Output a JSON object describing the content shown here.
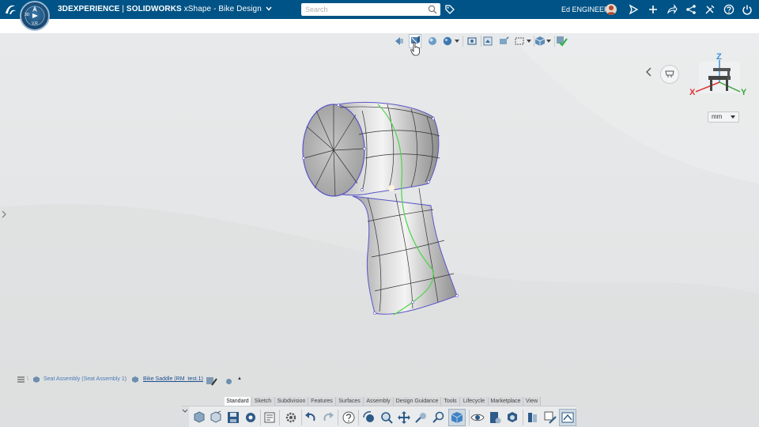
{
  "header": {
    "brand_bold": "3DEXPERIENCE",
    "separator": " | ",
    "product_bold": "SOLIDWORKS",
    "app_name": " xShape - Bike Design",
    "search_placeholder": "Search",
    "user_name": "Ed ENGINEER"
  },
  "compass": {
    "label_3d": "3D",
    "label_vr": "V,R"
  },
  "view": {
    "units": "mm",
    "triad": {
      "x": "X",
      "y": "Y",
      "z": "Z"
    }
  },
  "tree": {
    "root_label": "Seat Assembly (Seat Assembly 1)",
    "child_label": "Bike Saddle (RM_test.1)"
  },
  "action_bar": {
    "tabs": [
      "Standard",
      "Sketch",
      "Subdivision",
      "Features",
      "Surfaces",
      "Assembly",
      "Design Guidance",
      "Tools",
      "Lifecycle",
      "Marketplace",
      "View"
    ],
    "active_tab": "Standard"
  },
  "colors": {
    "topbar": "#005386",
    "viewport": "#e5e7e8",
    "model_edge": "#5a55c8",
    "symmetry_line": "#4fd34a",
    "axis_x": "#e03030",
    "axis_y": "#3aa63a",
    "axis_z": "#3a8fd8"
  }
}
